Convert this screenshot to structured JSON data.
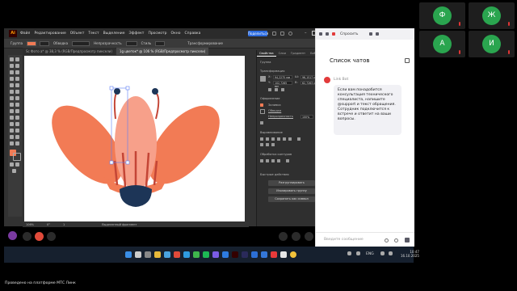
{
  "participants": [
    {
      "initial": "Ф"
    },
    {
      "initial": "Ж"
    },
    {
      "initial": "А"
    },
    {
      "initial": "И"
    }
  ],
  "illustrator": {
    "menu": [
      "Файл",
      "Редактирование",
      "Объект",
      "Текст",
      "Выделение",
      "Эффект",
      "Просмотр",
      "Окно",
      "Справка"
    ],
    "share_label": "Поделиться",
    "control_bar": {
      "stroke_label": "Обводка",
      "opacity_label": "Непрозрачность",
      "style_label": "Стиль",
      "transform_label": "Трансформирование"
    },
    "tabs": [
      "Sc Фото a* @ 38,3 % (RGB/Предпросмотр пиксели)",
      "1g цветок* @ 106 % (RGB/Предпросмотр пиксели)"
    ],
    "properties": {
      "tabs": [
        "Свойства",
        "Слои",
        "Градиент",
        "Библ."
      ],
      "group_label": "Группа",
      "transform_label": "Трансформация",
      "x_value": "94,2275 мм",
      "y_value": "102,7265 мм",
      "w_value": "96,1517 мм",
      "h_value": "62,7263 мм",
      "appearance_label": "Оформление",
      "fill_label": "Заливка",
      "stroke_label": "Обводка",
      "opacity_label": "Непрозрачность",
      "opacity_value": "100%",
      "align_label": "Выравнивание",
      "pathfinder_label": "Обработка контуров",
      "quick_actions_label": "Быстрые действия",
      "btn_ungroup": "Разгруппировать",
      "btn_isolate": "Изолировать группу",
      "btn_save_symbol": "Сохранить как символ"
    },
    "status": {
      "zoom": "106%",
      "angle": "0°",
      "page": "1",
      "selection": "Выделенный фрагмент"
    },
    "colors": {
      "petal_outer": "#f27b55",
      "petal_inner": "#f7a08a",
      "base": "#1d3557",
      "stamen": "#c44536"
    }
  },
  "chat": {
    "ask_button": "Спросить",
    "title": "Список чатов",
    "bot_name": "Link Bot",
    "message": "Если вам понадобится консультация технического специалиста, напишите @support и текст обращения. Сотрудник подключится к встрече и ответит на ваши вопросы.",
    "input_placeholder": "Введите сообщение"
  },
  "taskbar": {
    "lang": "ENG",
    "time": "10:47",
    "date": "16.10.2025"
  },
  "footer": "Проведено на платформе МТС Линк"
}
